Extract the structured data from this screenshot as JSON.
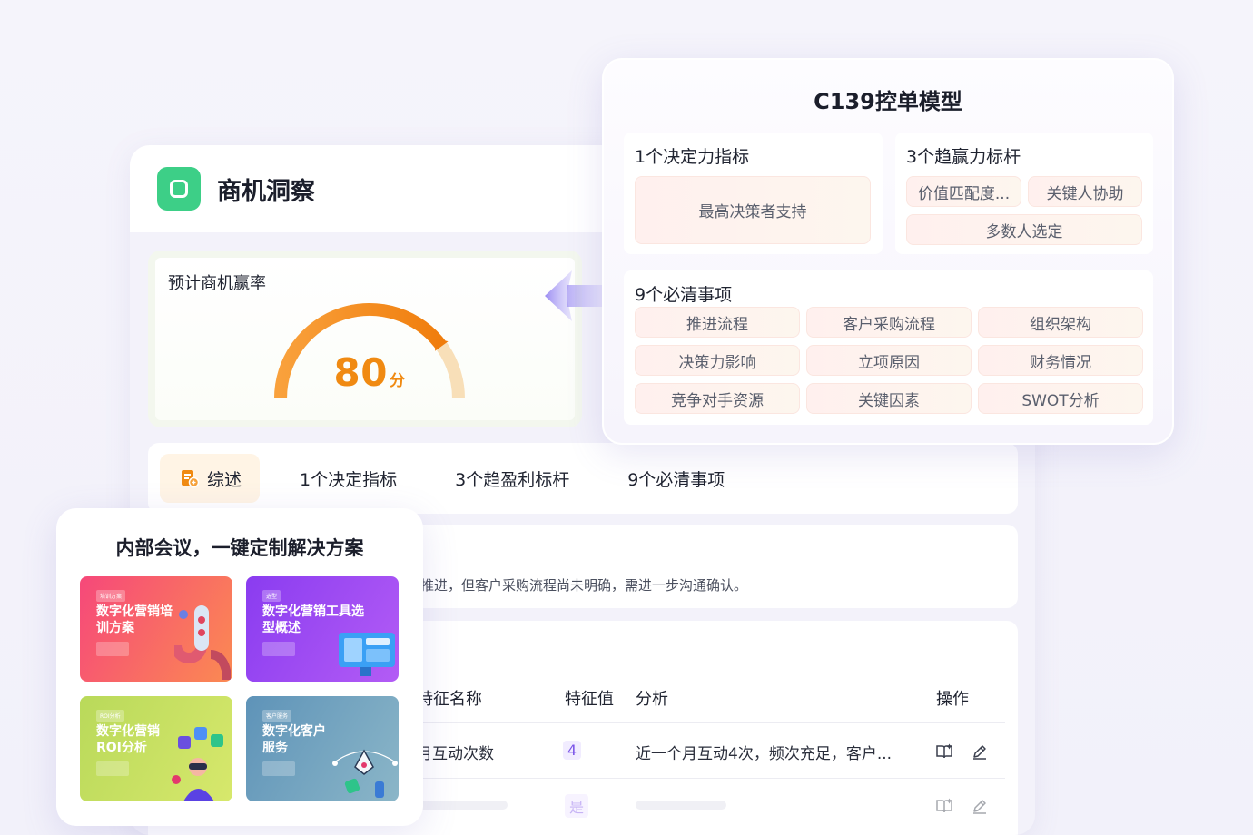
{
  "main": {
    "title": "商机洞察",
    "score": {
      "title": "预计商机赢率",
      "value": "80",
      "unit": "分",
      "fraction": 0.8,
      "color": "#f08a12"
    },
    "tabs": [
      {
        "label": "综述",
        "active": true
      },
      {
        "label": "1个决定指标",
        "active": false
      },
      {
        "label": "3个趋盈利标杆",
        "active": false
      },
      {
        "label": "9个必清事项",
        "active": false
      }
    ],
    "summary": "推进，但客户采购流程尚未明确，需进一步沟通确认。",
    "table": {
      "headers": [
        "特征名称",
        "特征值",
        "分析",
        "操作"
      ],
      "rows": [
        {
          "name": "月互动次数",
          "value": "4",
          "analysis": "近一个月互动4次，频次充足，客户..."
        },
        {
          "name": "",
          "value": "是",
          "analysis": ""
        }
      ]
    }
  },
  "model": {
    "title": "C139控单模型",
    "decision": {
      "title": "1个决定力指标",
      "items": [
        "最高决策者支持"
      ]
    },
    "benchmarks": {
      "title": "3个趋赢力标杆",
      "items": [
        "价值匹配度...",
        "关键人协助",
        "多数人选定"
      ]
    },
    "must_clear": {
      "title": "9个必清事项",
      "items": [
        "推进流程",
        "客户采购流程",
        "组织架构",
        "决策力影响",
        "立项原因",
        "财务情况",
        "竞争对手资源",
        "关键因素",
        "SWOT分析"
      ]
    }
  },
  "meeting": {
    "title": "内部会议，一键定制解决方案",
    "tiles": [
      {
        "tag": "培训方案",
        "title": "数字化营销培训方案",
        "color_from": "#f6487a",
        "color_to": "#fb8a52"
      },
      {
        "tag": "选型",
        "title": "数字化营销工具选型概述",
        "color_from": "#8a3cf0",
        "color_to": "#b35cf5"
      },
      {
        "tag": "ROI分析",
        "title": "数字化营销ROI分析",
        "color_from": "#b9d95a",
        "color_to": "#d7e86c"
      },
      {
        "tag": "客户服务",
        "title": "数字化客户服务",
        "color_from": "#5e93b8",
        "color_to": "#8bb6c8"
      }
    ]
  },
  "colors": {
    "accent": "#f08a12",
    "brand_green": "#3dcf87",
    "badge_purple": "#7b55e8"
  }
}
